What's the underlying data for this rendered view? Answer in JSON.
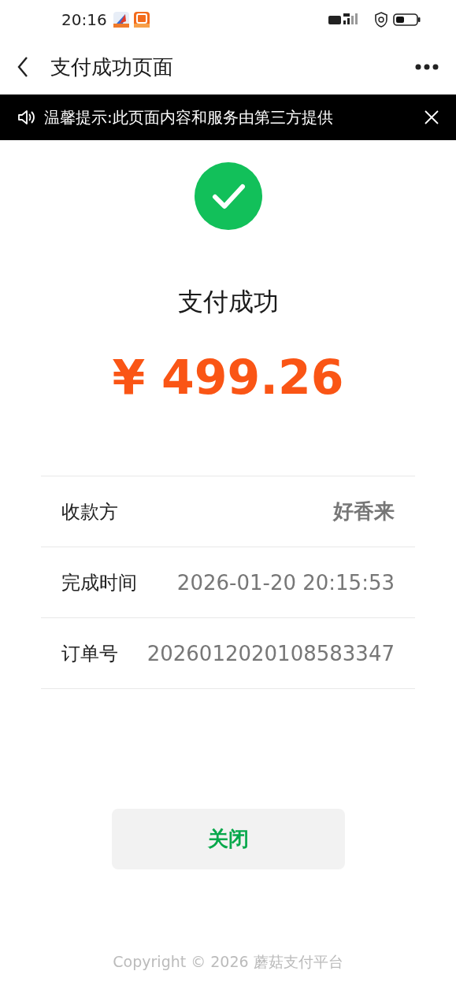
{
  "status_bar": {
    "time": "20:16"
  },
  "nav": {
    "title": "支付成功页面"
  },
  "notice": {
    "text": "温馨提示:此页面内容和服务由第三方提供"
  },
  "result": {
    "title": "支付成功",
    "amount": "¥ 499.26"
  },
  "details": [
    {
      "label": "收款方",
      "value": "好香来",
      "bold": true
    },
    {
      "label": "完成时间",
      "value": "2026-01-20 20:15:53",
      "bold": false
    },
    {
      "label": "订单号",
      "value": "2026012020108583347",
      "bold": false
    }
  ],
  "close_button": "关闭",
  "footer": "Copyright © 2026 蘑菇支付平台"
}
